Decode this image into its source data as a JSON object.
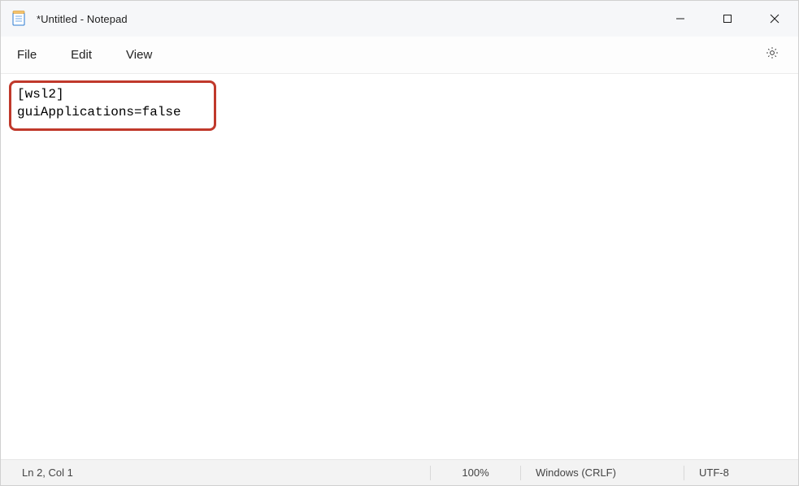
{
  "window": {
    "title": "*Untitled - Notepad"
  },
  "menu": {
    "file": "File",
    "edit": "Edit",
    "view": "View"
  },
  "editor": {
    "content": "[wsl2]\nguiApplications=false"
  },
  "status": {
    "cursor": "Ln 2, Col 1",
    "zoom": "100%",
    "eol": "Windows (CRLF)",
    "encoding": "UTF-8"
  }
}
